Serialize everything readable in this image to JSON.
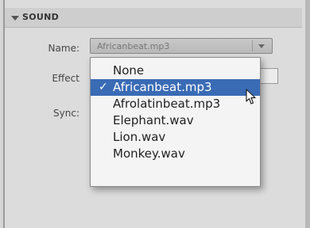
{
  "panel": {
    "section_title": "SOUND"
  },
  "labels": {
    "name": "Name:",
    "effect": "Effect",
    "sync": "Sync:"
  },
  "name_combo": {
    "selected_value": "Africanbeat.mp3"
  },
  "dropdown": {
    "items": [
      {
        "label": "None",
        "selected": false
      },
      {
        "label": "Africanbeat.mp3",
        "selected": true
      },
      {
        "label": "Afrolatinbeat.mp3",
        "selected": false
      },
      {
        "label": "Elephant.wav",
        "selected": false
      },
      {
        "label": "Lion.wav",
        "selected": false
      },
      {
        "label": "Monkey.wav",
        "selected": false
      }
    ],
    "check_glyph": "✓"
  },
  "colors": {
    "selection": "#3a6bb5",
    "panel_bg": "#dcdcdc"
  }
}
